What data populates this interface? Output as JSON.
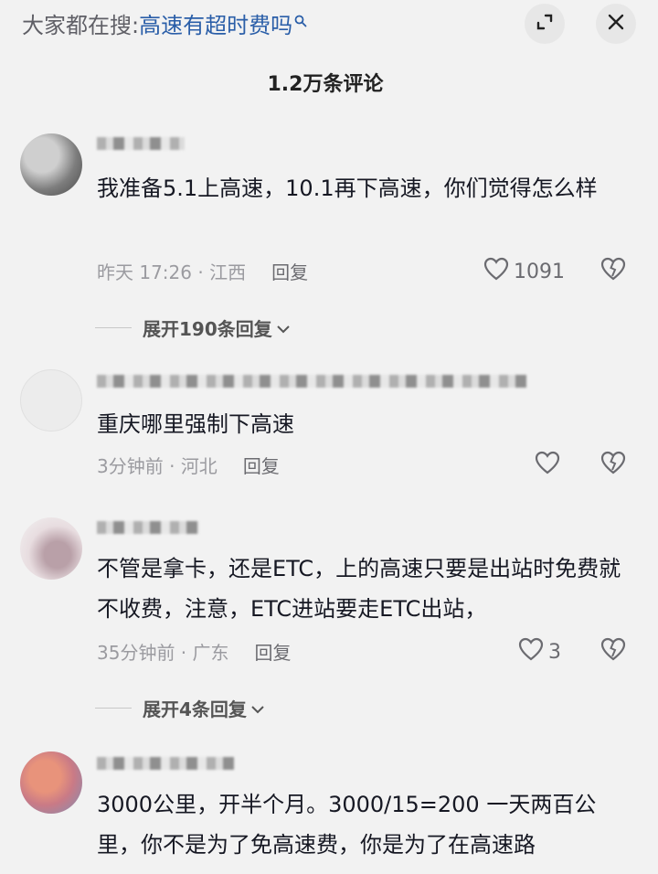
{
  "top": {
    "search_prefix": "大家都在搜:",
    "search_query": "高速有超时费吗",
    "search_icon": "search-icon",
    "collapse_icon": "collapse-icon",
    "close_icon": "close-icon"
  },
  "comment_count": "1.2万条评论",
  "comments": [
    {
      "text": "我准备5.1上高速，10.1再下高速，你们觉得怎么样",
      "time": "昨天 17:26",
      "location": "江西",
      "reply": "回复",
      "likes": "1091",
      "expand": "展开190条回复"
    },
    {
      "text": "重庆哪里强制下高速",
      "time": "3分钟前",
      "location": "河北",
      "reply": "回复",
      "likes": ""
    },
    {
      "text": "不管是拿卡，还是ETC，上的高速只要是出站时免费就不收费，注意，ETC进站要走ETC出站，",
      "time": "35分钟前",
      "location": "广东",
      "reply": "回复",
      "likes": "3",
      "expand": "展开4条回复"
    },
    {
      "text": "3000公里，开半个月。3000/15=200  一天两百公里，你不是为了免高速费，你是为了在高速路"
    }
  ],
  "meta_separator": " · "
}
